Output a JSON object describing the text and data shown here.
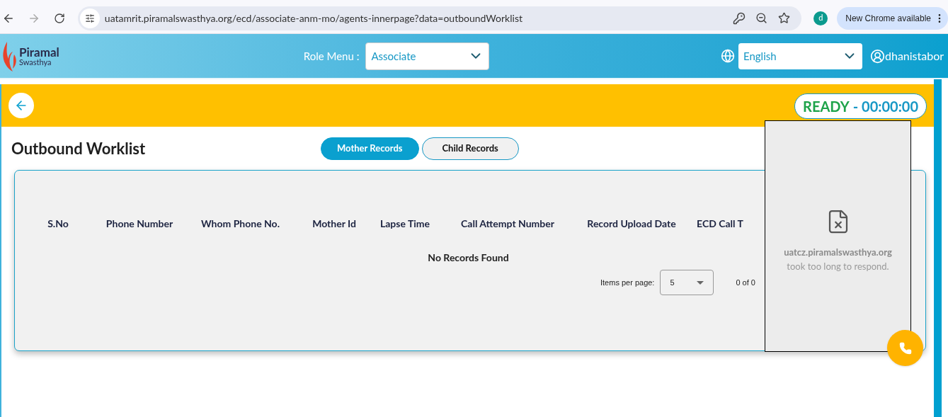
{
  "browser": {
    "url": "uatamrit.piramalswasthya.org/ecd/associate-anm-mo/agents-innerpage?data=outboundWorklist",
    "profile_initial": "d",
    "update_button": "New Chrome available"
  },
  "header": {
    "logo_name": "Piramal",
    "logo_sub": "Swasthya",
    "role_label": "Role Menu :",
    "role_value": "Associate",
    "language": "English",
    "user": "dhanistabor"
  },
  "status_bar": {
    "status": "READY",
    "separator": "-",
    "timer": "00:00:00"
  },
  "page_title": "Outbound Worklist",
  "tabs": [
    {
      "label": "Mother Records",
      "selected": true
    },
    {
      "label": "Child Records",
      "selected": false
    }
  ],
  "table": {
    "columns": [
      "S.No",
      "Phone Number",
      "Whom Phone No.",
      "Mother Id",
      "Lapse Time",
      "Call Attempt Number",
      "Record Upload Date",
      "ECD Call T"
    ],
    "empty_message": "No Records Found"
  },
  "paginator": {
    "items_label": "Items per page:",
    "page_size": "5",
    "range": "0 of 0"
  },
  "error_popup": {
    "host": "uatcz.piramalswasthya.org",
    "message": "took too long to respond."
  }
}
